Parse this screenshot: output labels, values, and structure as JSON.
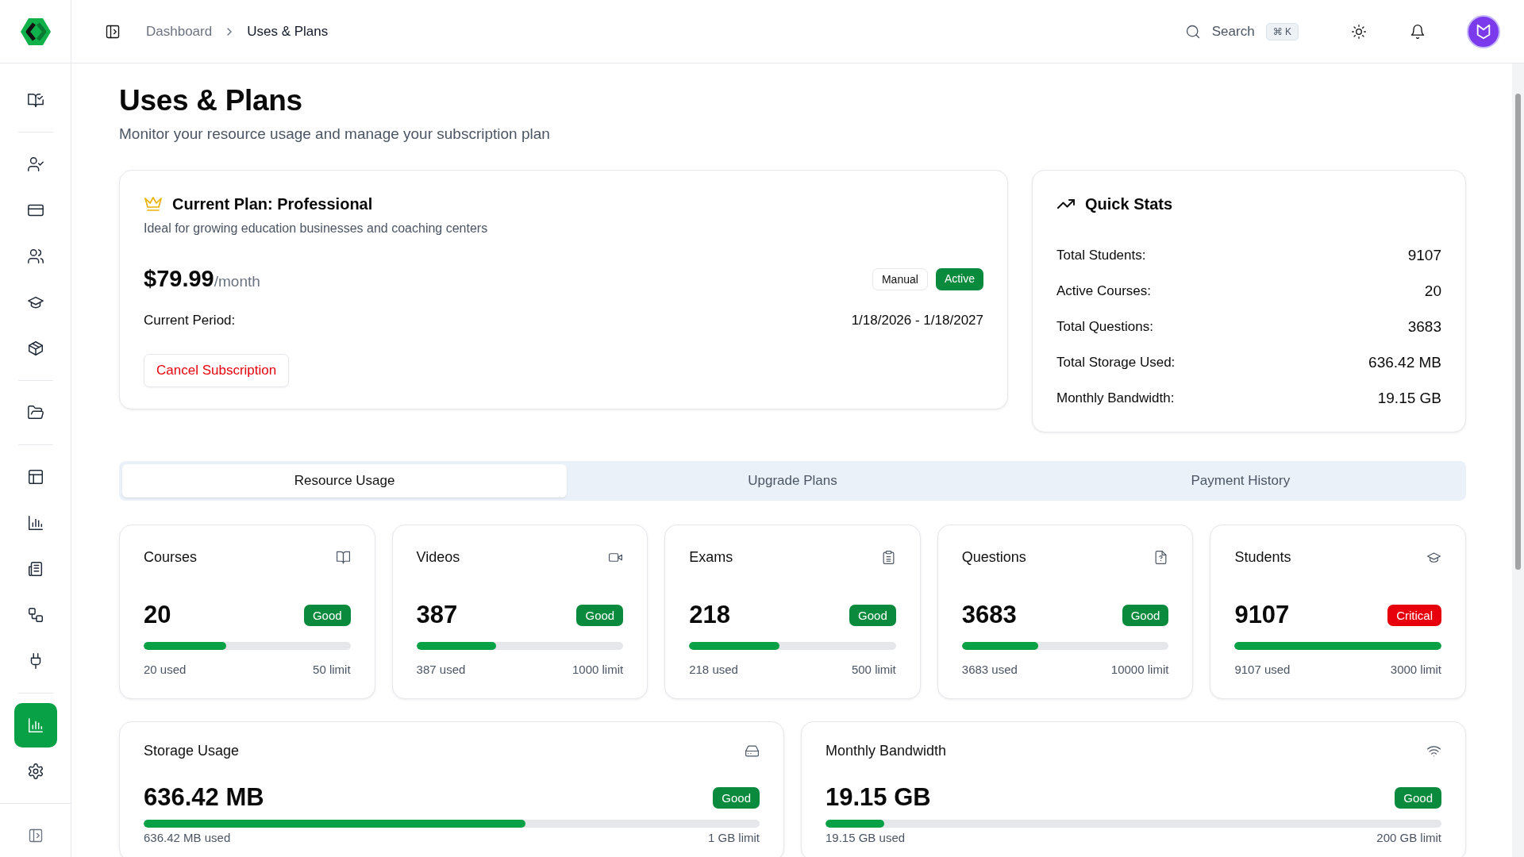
{
  "sidebar": {
    "groups": [
      [
        {
          "kind": "book-check",
          "selected": false
        }
      ],
      [
        {
          "kind": "user-check",
          "selected": false
        },
        {
          "kind": "card",
          "selected": false
        },
        {
          "kind": "users",
          "selected": false
        },
        {
          "kind": "graduation",
          "selected": false
        },
        {
          "kind": "package",
          "selected": false
        }
      ],
      [
        {
          "kind": "folder",
          "selected": false
        }
      ],
      [
        {
          "kind": "layout",
          "selected": false
        },
        {
          "kind": "chart",
          "selected": false
        },
        {
          "kind": "newspaper",
          "selected": false
        },
        {
          "kind": "workflow",
          "selected": false
        },
        {
          "kind": "plug",
          "selected": false
        }
      ],
      [
        {
          "kind": "chart",
          "selected": true
        },
        {
          "kind": "settings",
          "selected": false
        }
      ]
    ]
  },
  "header": {
    "breadcrumbs": [
      "Dashboard",
      "Uses & Plans"
    ],
    "search": {
      "label": "Search",
      "shortcut": "⌘ K"
    }
  },
  "page": {
    "title": "Uses & Plans",
    "subtitle": "Monitor your resource usage and manage your subscription plan"
  },
  "plan": {
    "title": "Current Plan: Professional",
    "description": "Ideal for growing education businesses and coaching centers",
    "price": "$79.99",
    "price_unit": "/month",
    "badges": [
      {
        "label": "Manual",
        "kind": "outline"
      },
      {
        "label": "Active",
        "kind": "success"
      }
    ],
    "period_label": "Current Period:",
    "period_value": "1/18/2026 - 1/18/2027",
    "cancel_button": "Cancel Subscription"
  },
  "quick_stats": {
    "title": "Quick Stats",
    "rows": [
      {
        "label": "Total Students:",
        "value": "9107"
      },
      {
        "label": "Active Courses:",
        "value": "20"
      },
      {
        "label": "Total Questions:",
        "value": "3683"
      },
      {
        "label": "Total Storage Used:",
        "value": "636.42 MB"
      },
      {
        "label": "Monthly Bandwidth:",
        "value": "19.15 GB"
      }
    ]
  },
  "tabs": [
    {
      "label": "Resource Usage",
      "selected": true
    },
    {
      "label": "Upgrade Plans",
      "selected": false
    },
    {
      "label": "Payment History",
      "selected": false
    }
  ],
  "resources": [
    {
      "title": "Courses",
      "kind": "book",
      "value": "20",
      "status": {
        "label": "Good",
        "kind": "good"
      },
      "level": 0.4,
      "used": "20 used",
      "limit": "50 limit"
    },
    {
      "title": "Videos",
      "kind": "video",
      "value": "387",
      "status": {
        "label": "Good",
        "kind": "good"
      },
      "level": 0.387,
      "used": "387 used",
      "limit": "1000 limit"
    },
    {
      "title": "Exams",
      "kind": "clipboard",
      "value": "218",
      "status": {
        "label": "Good",
        "kind": "good"
      },
      "level": 0.436,
      "used": "218 used",
      "limit": "500 limit"
    },
    {
      "title": "Questions",
      "kind": "question",
      "value": "3683",
      "status": {
        "label": "Good",
        "kind": "good"
      },
      "level": 0.368,
      "used": "3683 used",
      "limit": "10000 limit"
    },
    {
      "title": "Students",
      "kind": "graduation",
      "value": "9107",
      "status": {
        "label": "Critical",
        "kind": "critical"
      },
      "level": 1,
      "used": "9107 used",
      "limit": "3000 limit"
    }
  ],
  "usage_panels": [
    {
      "title": "Storage Usage",
      "kind": "drive",
      "value": "636.42 MB",
      "status": {
        "label": "Good",
        "kind": "good"
      },
      "level": 0.62,
      "used": "636.42 MB used",
      "limit": "1 GB limit"
    },
    {
      "title": "Monthly Bandwidth",
      "kind": "wifi",
      "value": "19.15 GB",
      "status": {
        "label": "Good",
        "kind": "good"
      },
      "level": 0.096,
      "used": "19.15 GB used",
      "limit": "200 GB limit"
    }
  ]
}
